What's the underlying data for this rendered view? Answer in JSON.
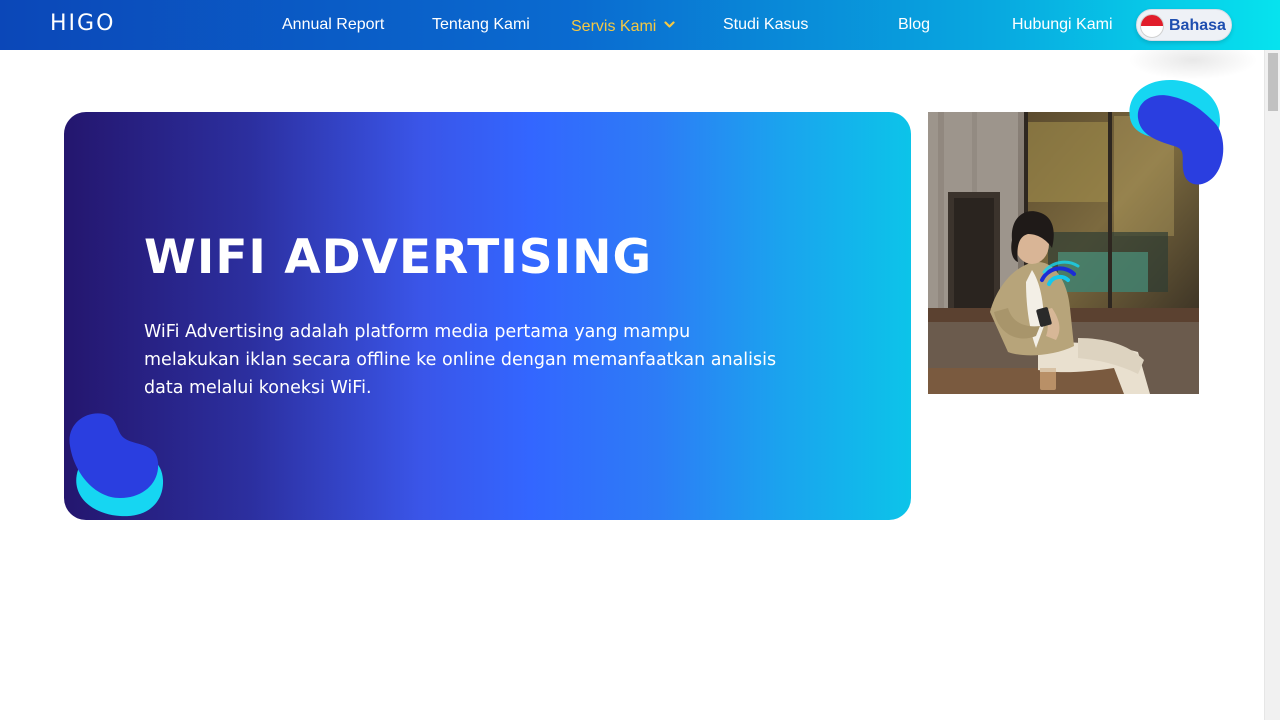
{
  "navbar": {
    "logo": "HIGO",
    "items": [
      {
        "label": "Annual Report"
      },
      {
        "label": "Tentang Kami"
      },
      {
        "label": "Servis Kami",
        "active": true
      },
      {
        "label": "Studi Kasus"
      },
      {
        "label": "Blog"
      },
      {
        "label": "Hubungi Kami"
      }
    ],
    "language": {
      "label": "Bahasa",
      "flag": "indonesia-flag-icon"
    }
  },
  "hero": {
    "title": "WIFI ADVERTISING",
    "description": "WiFi Advertising adalah platform media pertama yang mampu melakukan iklan secara offline ke online dengan memanfaatkan analisis data melalui koneksi WiFi."
  },
  "colors": {
    "nav_active": "#f5c842",
    "blob_blue": "#2a3ee0",
    "blob_cyan": "#16d6f2",
    "hero_start": "#24166e",
    "hero_end": "#0cc4e9"
  }
}
